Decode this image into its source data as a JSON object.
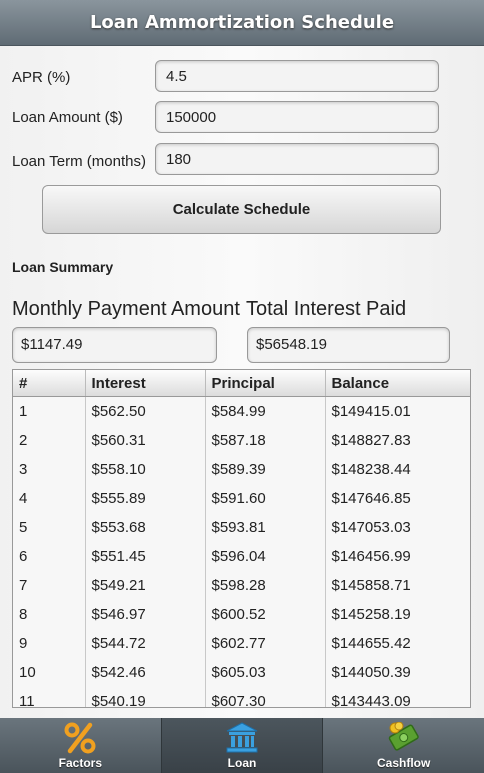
{
  "header": {
    "title": "Loan Ammortization Schedule"
  },
  "form": {
    "apr_label": "APR (%)",
    "apr_value": "4.5",
    "amount_label": "Loan Amount ($)",
    "amount_value": "150000",
    "term_label": "Loan Term (months)",
    "term_value": "180",
    "calculate_label": "Calculate Schedule"
  },
  "summary": {
    "title": "Loan Summary",
    "monthly_label": "Monthly Payment Amount",
    "interest_label": "Total Interest Paid",
    "monthly_value": "$1147.49",
    "interest_value": "$56548.19"
  },
  "table": {
    "headers": [
      "#",
      "Interest",
      "Principal",
      "Balance"
    ],
    "rows": [
      [
        "1",
        "$562.50",
        "$584.99",
        "$149415.01"
      ],
      [
        "2",
        "$560.31",
        "$587.18",
        "$148827.83"
      ],
      [
        "3",
        "$558.10",
        "$589.39",
        "$148238.44"
      ],
      [
        "4",
        "$555.89",
        "$591.60",
        "$147646.85"
      ],
      [
        "5",
        "$553.68",
        "$593.81",
        "$147053.03"
      ],
      [
        "6",
        "$551.45",
        "$596.04",
        "$146456.99"
      ],
      [
        "7",
        "$549.21",
        "$598.28",
        "$145858.71"
      ],
      [
        "8",
        "$546.97",
        "$600.52",
        "$145258.19"
      ],
      [
        "9",
        "$544.72",
        "$602.77",
        "$144655.42"
      ],
      [
        "10",
        "$542.46",
        "$605.03",
        "$144050.39"
      ],
      [
        "11",
        "$540.19",
        "$607.30",
        "$143443.09"
      ]
    ]
  },
  "tabs": [
    {
      "label": "Factors",
      "icon": "percent-icon",
      "active": false
    },
    {
      "label": "Loan",
      "icon": "bank-icon",
      "active": true
    },
    {
      "label": "Cashflow",
      "icon": "money-icon",
      "active": false
    }
  ],
  "colors": {
    "header_bg": "#6f7a82",
    "tab_bg": "#4a545b",
    "percent_icon": "#f0a020",
    "bank_icon": "#3aa0e0",
    "money_icon": "#5aa030"
  }
}
